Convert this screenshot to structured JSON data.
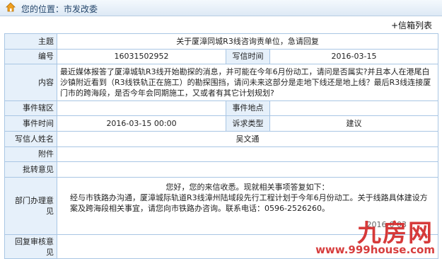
{
  "header": {
    "location": "您的位置：市发改委",
    "list_link": "+信箱列表"
  },
  "labels": {
    "subject": "主题",
    "number": "编号",
    "write_time": "写信时间",
    "content": "内容",
    "jurisdiction": "事件辖区",
    "location": "事件地点",
    "event_time": "事件时间",
    "appeal_type": "诉求类型",
    "writer": "写信人姓名",
    "attachment": "附件",
    "approval": "批转意见",
    "dept_opinion": "部门办理意见",
    "review": "回复审核意见"
  },
  "values": {
    "subject": "关于厦漳同城R3线咨询责单位，急请回复",
    "number": "16031502952",
    "write_time": "2016-03-15",
    "content": "最近媒体报答了厦漳城轨R3线开始勘探的消息，并可能在今年6月份动工，请问是否属实?并且本人在港尾白沙镇附近看到（R3线铁轨正在施工）的勘探围挡，请问未来这部分是走地下线还是地上线？最后R3线连接厦门市的跨海段，是否今年会同期施工，又或者有其它计划规划?",
    "jurisdiction": "",
    "location": "",
    "event_time": "2016-03-15 00:00",
    "appeal_type": "建议",
    "writer": "吴文通",
    "attachment": "",
    "approval": "",
    "reply_line1": "您好，您的来信收悉。现就相关事项答复如下：",
    "reply_line2": "经与市铁路办沟通，厦漳城际轨道R3线漳州陆域段先行工程计划于今年6月份动工。关于线路具体建设方案及跨海段相关事宜，请您向市铁路办咨询。联系电话：0596-2526260。",
    "reply_date": "2016-0    03",
    "review": ""
  },
  "watermark": {
    "brand": "九房网",
    "site": "www.999house.com"
  },
  "colors": {
    "label_bg": "#e6f0fa",
    "border": "#a9c6e4",
    "brand_red": "#d32a2a"
  },
  "icons": {
    "home": "home-icon"
  }
}
